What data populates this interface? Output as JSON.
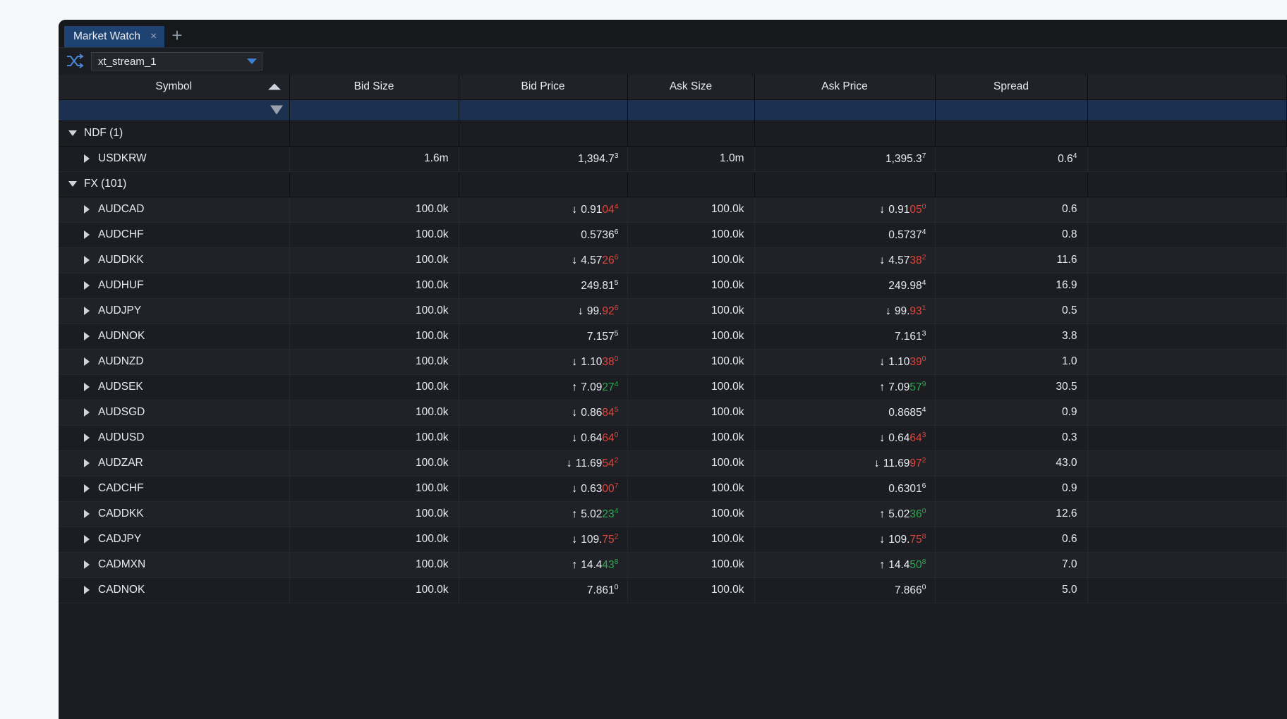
{
  "window": {
    "tab_label": "Market Watch",
    "tab_close": "×",
    "tab_add": "+"
  },
  "toolbar": {
    "stream_value": "xt_stream_1",
    "shuffle_icon": "shuffle-icon",
    "dropdown_icon": "chevron-down-icon"
  },
  "columns": [
    {
      "key": "symbol",
      "label": "Symbol"
    },
    {
      "key": "bid_size",
      "label": "Bid Size"
    },
    {
      "key": "bid_price",
      "label": "Bid Price"
    },
    {
      "key": "ask_size",
      "label": "Ask Size"
    },
    {
      "key": "ask_price",
      "label": "Ask Price"
    },
    {
      "key": "spread",
      "label": "Spread"
    }
  ],
  "colors": {
    "up": "#2fa84f",
    "down": "#e0453b",
    "neutral": "#e8ecf1",
    "tab_active": "#1e4272",
    "filter_row": "#1c3050"
  },
  "rows": [
    {
      "type": "group",
      "label": "NDF (1)",
      "expanded": true
    },
    {
      "type": "data",
      "symbol": "USDKRW",
      "bid_size": "1.6m",
      "ask_size": "1.0m",
      "spread": "0.6",
      "spread_pip": "4",
      "bid": {
        "dir": "none",
        "head": "1,394.7",
        "big": "",
        "pip": "3"
      },
      "ask": {
        "dir": "none",
        "head": "1,395.3",
        "big": "",
        "pip": "7"
      }
    },
    {
      "type": "group",
      "label": "FX (101)",
      "expanded": true
    },
    {
      "type": "data",
      "symbol": "AUDCAD",
      "bid_size": "100.0k",
      "ask_size": "100.0k",
      "spread": "0.6",
      "spread_pip": "",
      "bid": {
        "dir": "down",
        "head": "0.91",
        "big": "04",
        "pip": "4"
      },
      "ask": {
        "dir": "down",
        "head": "0.91",
        "big": "05",
        "pip": "0"
      }
    },
    {
      "type": "data",
      "symbol": "AUDCHF",
      "bid_size": "100.0k",
      "ask_size": "100.0k",
      "spread": "0.8",
      "spread_pip": "",
      "bid": {
        "dir": "none",
        "head": "0.5736",
        "big": "",
        "pip": "6"
      },
      "ask": {
        "dir": "none",
        "head": "0.5737",
        "big": "",
        "pip": "4"
      }
    },
    {
      "type": "data",
      "symbol": "AUDDKK",
      "bid_size": "100.0k",
      "ask_size": "100.0k",
      "spread": "11.6",
      "spread_pip": "",
      "bid": {
        "dir": "down",
        "head": "4.57",
        "big": "26",
        "pip": "6"
      },
      "ask": {
        "dir": "down",
        "head": "4.57",
        "big": "38",
        "pip": "2"
      }
    },
    {
      "type": "data",
      "symbol": "AUDHUF",
      "bid_size": "100.0k",
      "ask_size": "100.0k",
      "spread": "16.9",
      "spread_pip": "",
      "bid": {
        "dir": "none",
        "head": "249.81",
        "big": "",
        "pip": "5"
      },
      "ask": {
        "dir": "none",
        "head": "249.98",
        "big": "",
        "pip": "4"
      }
    },
    {
      "type": "data",
      "symbol": "AUDJPY",
      "bid_size": "100.0k",
      "ask_size": "100.0k",
      "spread": "0.5",
      "spread_pip": "",
      "bid": {
        "dir": "down",
        "head": "99.",
        "big": "92",
        "pip": "6"
      },
      "ask": {
        "dir": "down",
        "head": "99.",
        "big": "93",
        "pip": "1"
      }
    },
    {
      "type": "data",
      "symbol": "AUDNOK",
      "bid_size": "100.0k",
      "ask_size": "100.0k",
      "spread": "3.8",
      "spread_pip": "",
      "bid": {
        "dir": "none",
        "head": "7.157",
        "big": "",
        "pip": "5"
      },
      "ask": {
        "dir": "none",
        "head": "7.161",
        "big": "",
        "pip": "3"
      }
    },
    {
      "type": "data",
      "symbol": "AUDNZD",
      "bid_size": "100.0k",
      "ask_size": "100.0k",
      "spread": "1.0",
      "spread_pip": "",
      "bid": {
        "dir": "down",
        "head": "1.10",
        "big": "38",
        "pip": "0"
      },
      "ask": {
        "dir": "down",
        "head": "1.10",
        "big": "39",
        "pip": "0"
      }
    },
    {
      "type": "data",
      "symbol": "AUDSEK",
      "bid_size": "100.0k",
      "ask_size": "100.0k",
      "spread": "30.5",
      "spread_pip": "",
      "bid": {
        "dir": "up",
        "head": "7.09",
        "big": "27",
        "pip": "4"
      },
      "ask": {
        "dir": "up",
        "head": "7.09",
        "big": "57",
        "pip": "9"
      }
    },
    {
      "type": "data",
      "symbol": "AUDSGD",
      "bid_size": "100.0k",
      "ask_size": "100.0k",
      "spread": "0.9",
      "spread_pip": "",
      "bid": {
        "dir": "down",
        "head": "0.86",
        "big": "84",
        "pip": "5"
      },
      "ask": {
        "dir": "none",
        "head": "0.8685",
        "big": "",
        "pip": "4"
      }
    },
    {
      "type": "data",
      "symbol": "AUDUSD",
      "bid_size": "100.0k",
      "ask_size": "100.0k",
      "spread": "0.3",
      "spread_pip": "",
      "bid": {
        "dir": "down",
        "head": "0.64",
        "big": "64",
        "pip": "0"
      },
      "ask": {
        "dir": "down",
        "head": "0.64",
        "big": "64",
        "pip": "3"
      }
    },
    {
      "type": "data",
      "symbol": "AUDZAR",
      "bid_size": "100.0k",
      "ask_size": "100.0k",
      "spread": "43.0",
      "spread_pip": "",
      "bid": {
        "dir": "down",
        "head": "11.69",
        "big": "54",
        "pip": "2"
      },
      "ask": {
        "dir": "down",
        "head": "11.69",
        "big": "97",
        "pip": "2"
      }
    },
    {
      "type": "data",
      "symbol": "CADCHF",
      "bid_size": "100.0k",
      "ask_size": "100.0k",
      "spread": "0.9",
      "spread_pip": "",
      "bid": {
        "dir": "down",
        "head": "0.63",
        "big": "00",
        "pip": "7"
      },
      "ask": {
        "dir": "none",
        "head": "0.6301",
        "big": "",
        "pip": "6"
      }
    },
    {
      "type": "data",
      "symbol": "CADDKK",
      "bid_size": "100.0k",
      "ask_size": "100.0k",
      "spread": "12.6",
      "spread_pip": "",
      "bid": {
        "dir": "up",
        "head": "5.02",
        "big": "23",
        "pip": "4"
      },
      "ask": {
        "dir": "up",
        "head": "5.02",
        "big": "36",
        "pip": "0"
      }
    },
    {
      "type": "data",
      "symbol": "CADJPY",
      "bid_size": "100.0k",
      "ask_size": "100.0k",
      "spread": "0.6",
      "spread_pip": "",
      "bid": {
        "dir": "down",
        "head": "109.",
        "big": "75",
        "pip": "2"
      },
      "ask": {
        "dir": "down",
        "head": "109.",
        "big": "75",
        "pip": "8"
      }
    },
    {
      "type": "data",
      "symbol": "CADMXN",
      "bid_size": "100.0k",
      "ask_size": "100.0k",
      "spread": "7.0",
      "spread_pip": "",
      "bid": {
        "dir": "up",
        "head": "14.4",
        "big": "43",
        "pip": "8"
      },
      "ask": {
        "dir": "up",
        "head": "14.4",
        "big": "50",
        "pip": "8"
      }
    },
    {
      "type": "data",
      "symbol": "CADNOK",
      "bid_size": "100.0k",
      "ask_size": "100.0k",
      "spread": "5.0",
      "spread_pip": "",
      "bid": {
        "dir": "none",
        "head": "7.861",
        "big": "",
        "pip": "0"
      },
      "ask": {
        "dir": "none",
        "head": "7.866",
        "big": "",
        "pip": "0"
      }
    }
  ]
}
